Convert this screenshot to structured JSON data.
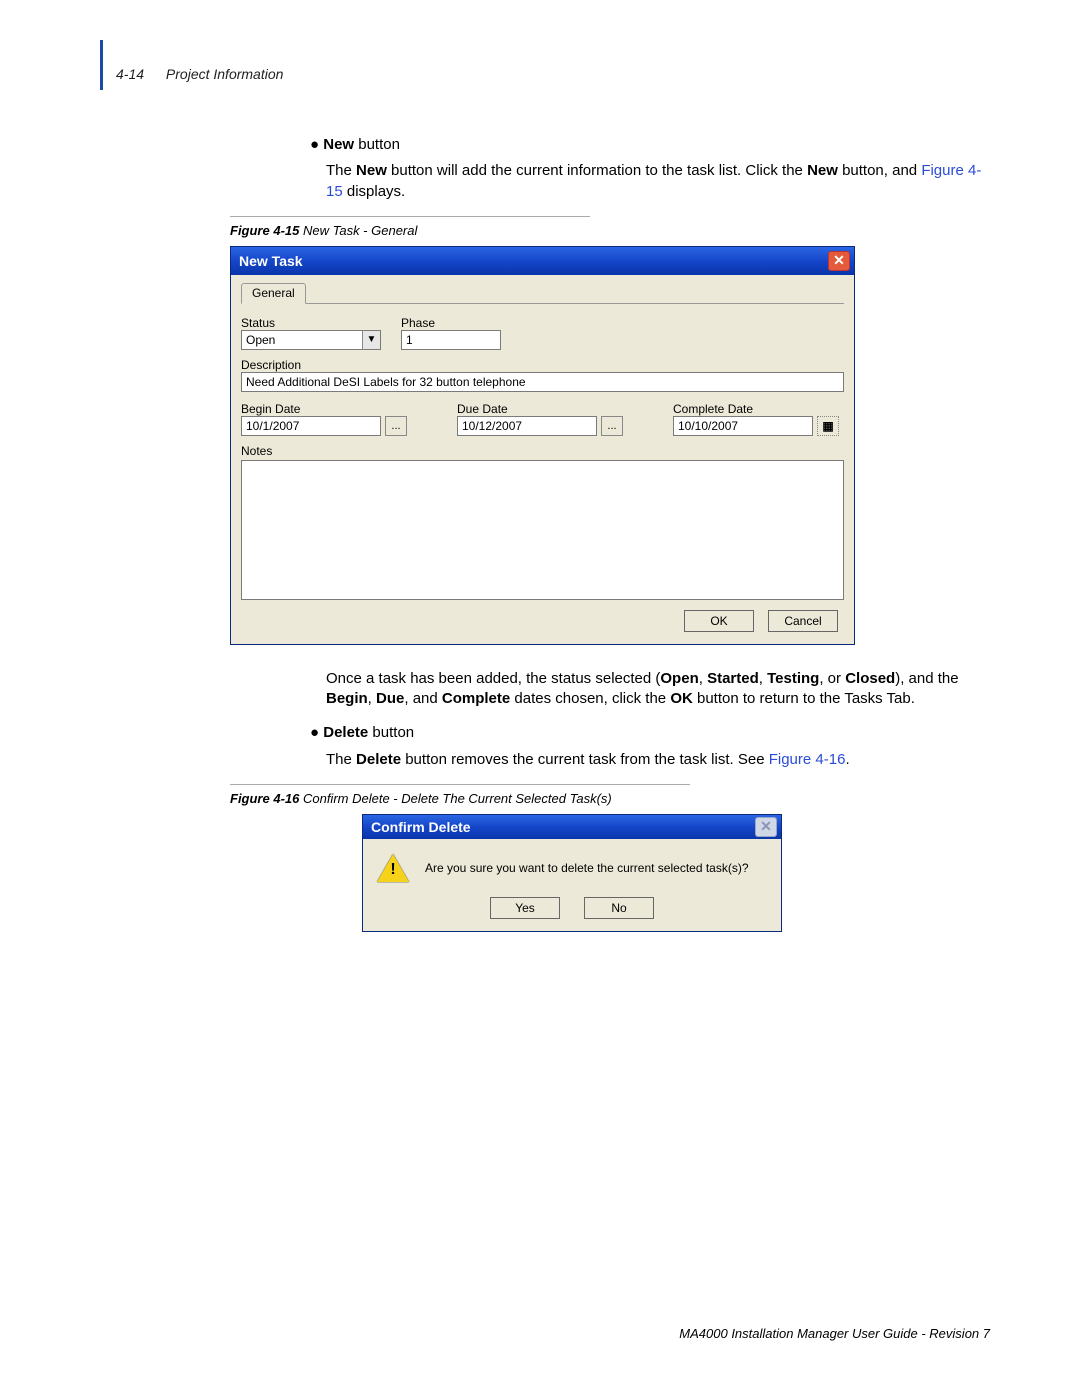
{
  "header": {
    "page_num": "4-14",
    "section": "Project Information"
  },
  "body": {
    "bullet1": {
      "bold": "New",
      "rest": " button"
    },
    "p1a": "The ",
    "p1b": "New",
    "p1c": " button will add the current information to the task list. Click the ",
    "p1d": "New",
    "p1e": " button, and ",
    "p1f": "Figure 4-15",
    "p1g": " displays.",
    "fig15": {
      "label": "Figure 4-15",
      "title": "  New Task - General"
    },
    "p2a": "Once a task has been added, the status selected (",
    "p2_open": "Open",
    "p2_c1": ", ",
    "p2_started": "Started",
    "p2_c2": ", ",
    "p2_testing": "Testing",
    "p2_c3": ", or ",
    "p2_closed": "Closed",
    "p2_mid": "), and the ",
    "p2_begin": "Begin",
    "p2_c4": ", ",
    "p2_due": "Due",
    "p2_c5": ", and ",
    "p2_complete": "Complete",
    "p2_end1": " dates chosen, click the ",
    "p2_ok": "OK",
    "p2_end2": " button to return to the Tasks Tab.",
    "bullet2": {
      "bold": "Delete",
      "rest": " button"
    },
    "p3a": "The ",
    "p3b": "Delete",
    "p3c": " button removes the current task from the task list. See ",
    "p3d": "Figure 4-16",
    "p3e": ".",
    "fig16": {
      "label": "Figure 4-16",
      "title": "  Confirm Delete - Delete The Current Selected Task(s)"
    }
  },
  "newtask": {
    "title": "New Task",
    "tab": "General",
    "status_label": "Status",
    "status_value": "Open",
    "phase_label": "Phase",
    "phase_value": "1",
    "description_label": "Description",
    "description_value": "Need Additional DeSI Labels for 32 button telephone",
    "begin_label": "Begin Date",
    "begin_value": "10/1/2007",
    "due_label": "Due Date",
    "due_value": "10/12/2007",
    "complete_label": "Complete Date",
    "complete_value": "10/10/2007",
    "notes_label": "Notes",
    "ok": "OK",
    "cancel": "Cancel",
    "pick": "..."
  },
  "confirm": {
    "title": "Confirm Delete",
    "msg": "Are you sure you want to delete the current selected task(s)?",
    "yes": "Yes",
    "no": "No"
  },
  "footer": "MA4000 Installation Manager User Guide - Revision 7"
}
